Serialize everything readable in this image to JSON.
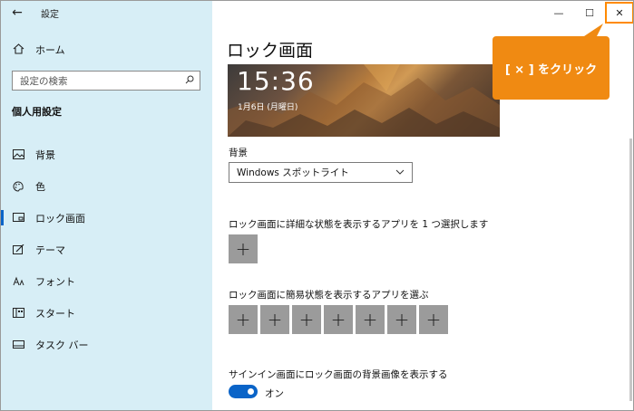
{
  "app": {
    "title": "設定",
    "back_glyph": "←"
  },
  "sidebar": {
    "home_label": "ホーム",
    "search_placeholder": "設定の検索",
    "section_title": "個人用設定",
    "items": [
      {
        "label": "背景",
        "icon": "picture-icon"
      },
      {
        "label": "色",
        "icon": "palette-icon"
      },
      {
        "label": "ロック画面",
        "icon": "lock-screen-icon",
        "active": true
      },
      {
        "label": "テーマ",
        "icon": "theme-brush-icon"
      },
      {
        "label": "フォント",
        "icon": "font-icon"
      },
      {
        "label": "スタート",
        "icon": "start-menu-icon"
      },
      {
        "label": "タスク バー",
        "icon": "taskbar-icon"
      }
    ]
  },
  "window_controls": {
    "minimize": "—",
    "maximize": "☐",
    "close": "✕"
  },
  "main": {
    "page_title": "ロック画面",
    "preview": {
      "time": "15:36",
      "date": "1月6日 (月曜日)"
    },
    "background_label": "背景",
    "background_value": "Windows スポットライト",
    "detail_app_label": "ロック画面に詳細な状態を表示するアプリを 1 つ選択します",
    "quick_apps_label": "ロック画面に簡易状態を表示するアプリを選ぶ",
    "add_glyph": "+",
    "signin_label": "サインイン画面にロック画面の背景画像を表示する",
    "toggle_state": "オン"
  },
  "annotation": {
    "text": "[ × ] をクリック",
    "color": "#f08a12"
  },
  "colors": {
    "accent": "#0a64c8",
    "sidebar_bg": "#d7eef6",
    "button_gray": "#9b9b9b"
  }
}
